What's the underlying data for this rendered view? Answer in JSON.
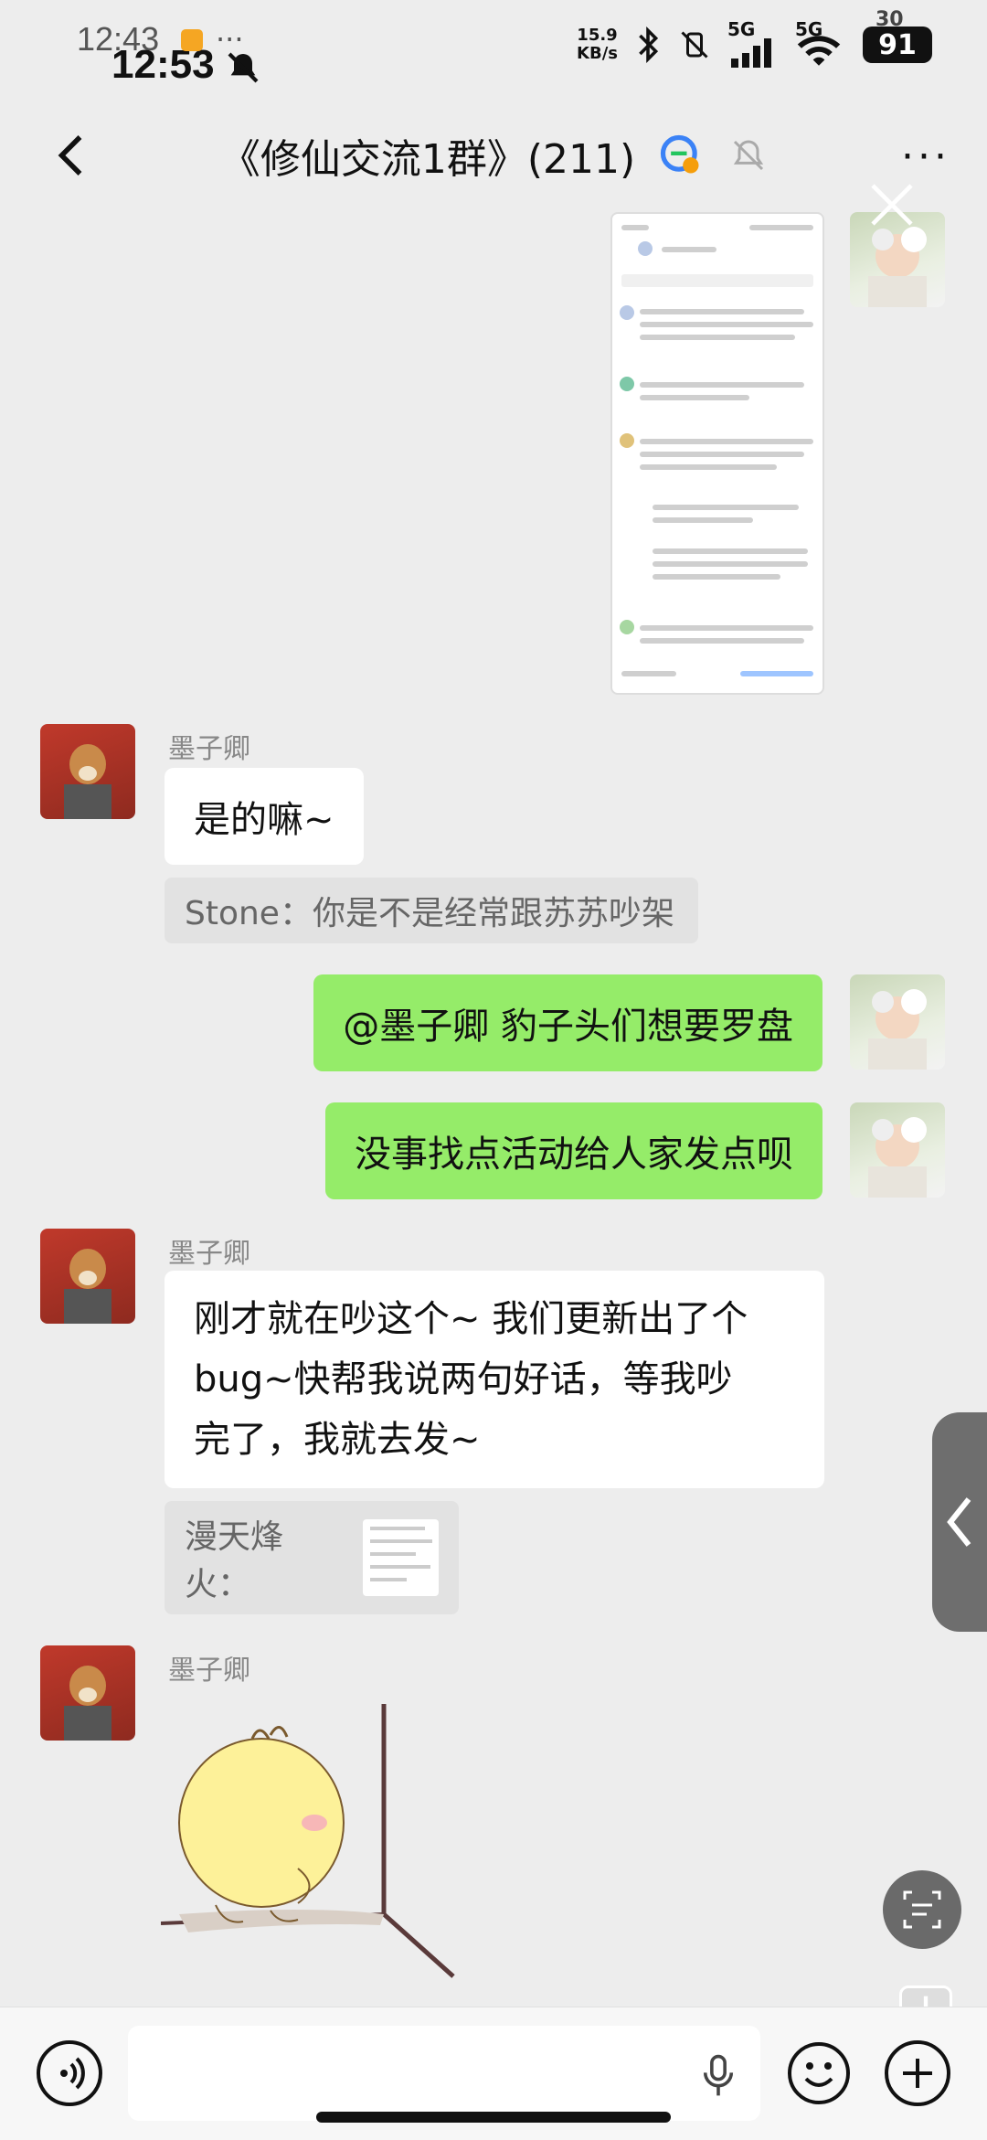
{
  "status_bar": {
    "time_back": "12:43",
    "time_front": "12:53",
    "net_speed_value": "15.9",
    "net_speed_unit": "KB/s",
    "signal_label_1": "5G",
    "signal_label_2": "5G",
    "battery_back": "30",
    "battery": "91"
  },
  "nav": {
    "back_icon": "chevron-left-icon",
    "title": "《修仙交流1群》(211)",
    "more_icon": "more-icon"
  },
  "messages": [
    {
      "type": "image",
      "side": "right",
      "description_icon": "screenshot-thumbnail"
    },
    {
      "type": "text",
      "side": "left",
      "sender": "墨子卿",
      "text": "是的嘛~"
    },
    {
      "type": "quote",
      "text": "Stone：你是不是经常跟苏苏吵架"
    },
    {
      "type": "text",
      "side": "right",
      "text": "@墨子卿  豹子头们想要罗盘"
    },
    {
      "type": "text",
      "side": "right",
      "text": "没事找点活动给人家发点呗"
    },
    {
      "type": "text",
      "side": "left",
      "sender": "墨子卿",
      "lines": [
        "刚才就在吵这个~ 我们更新出了个",
        "bug~快帮我说两句好话，等我吵",
        "完了，我就去发~"
      ]
    },
    {
      "type": "quote",
      "text": "漫天烽火："
    },
    {
      "type": "sticker",
      "side": "left",
      "sender": "墨子卿",
      "description_icon": "yellow-chick-sticker"
    }
  ],
  "input_bar": {
    "placeholder": ""
  },
  "colors": {
    "background": "#ededed",
    "self_bubble": "#95ec69",
    "other_bubble": "#ffffff"
  }
}
